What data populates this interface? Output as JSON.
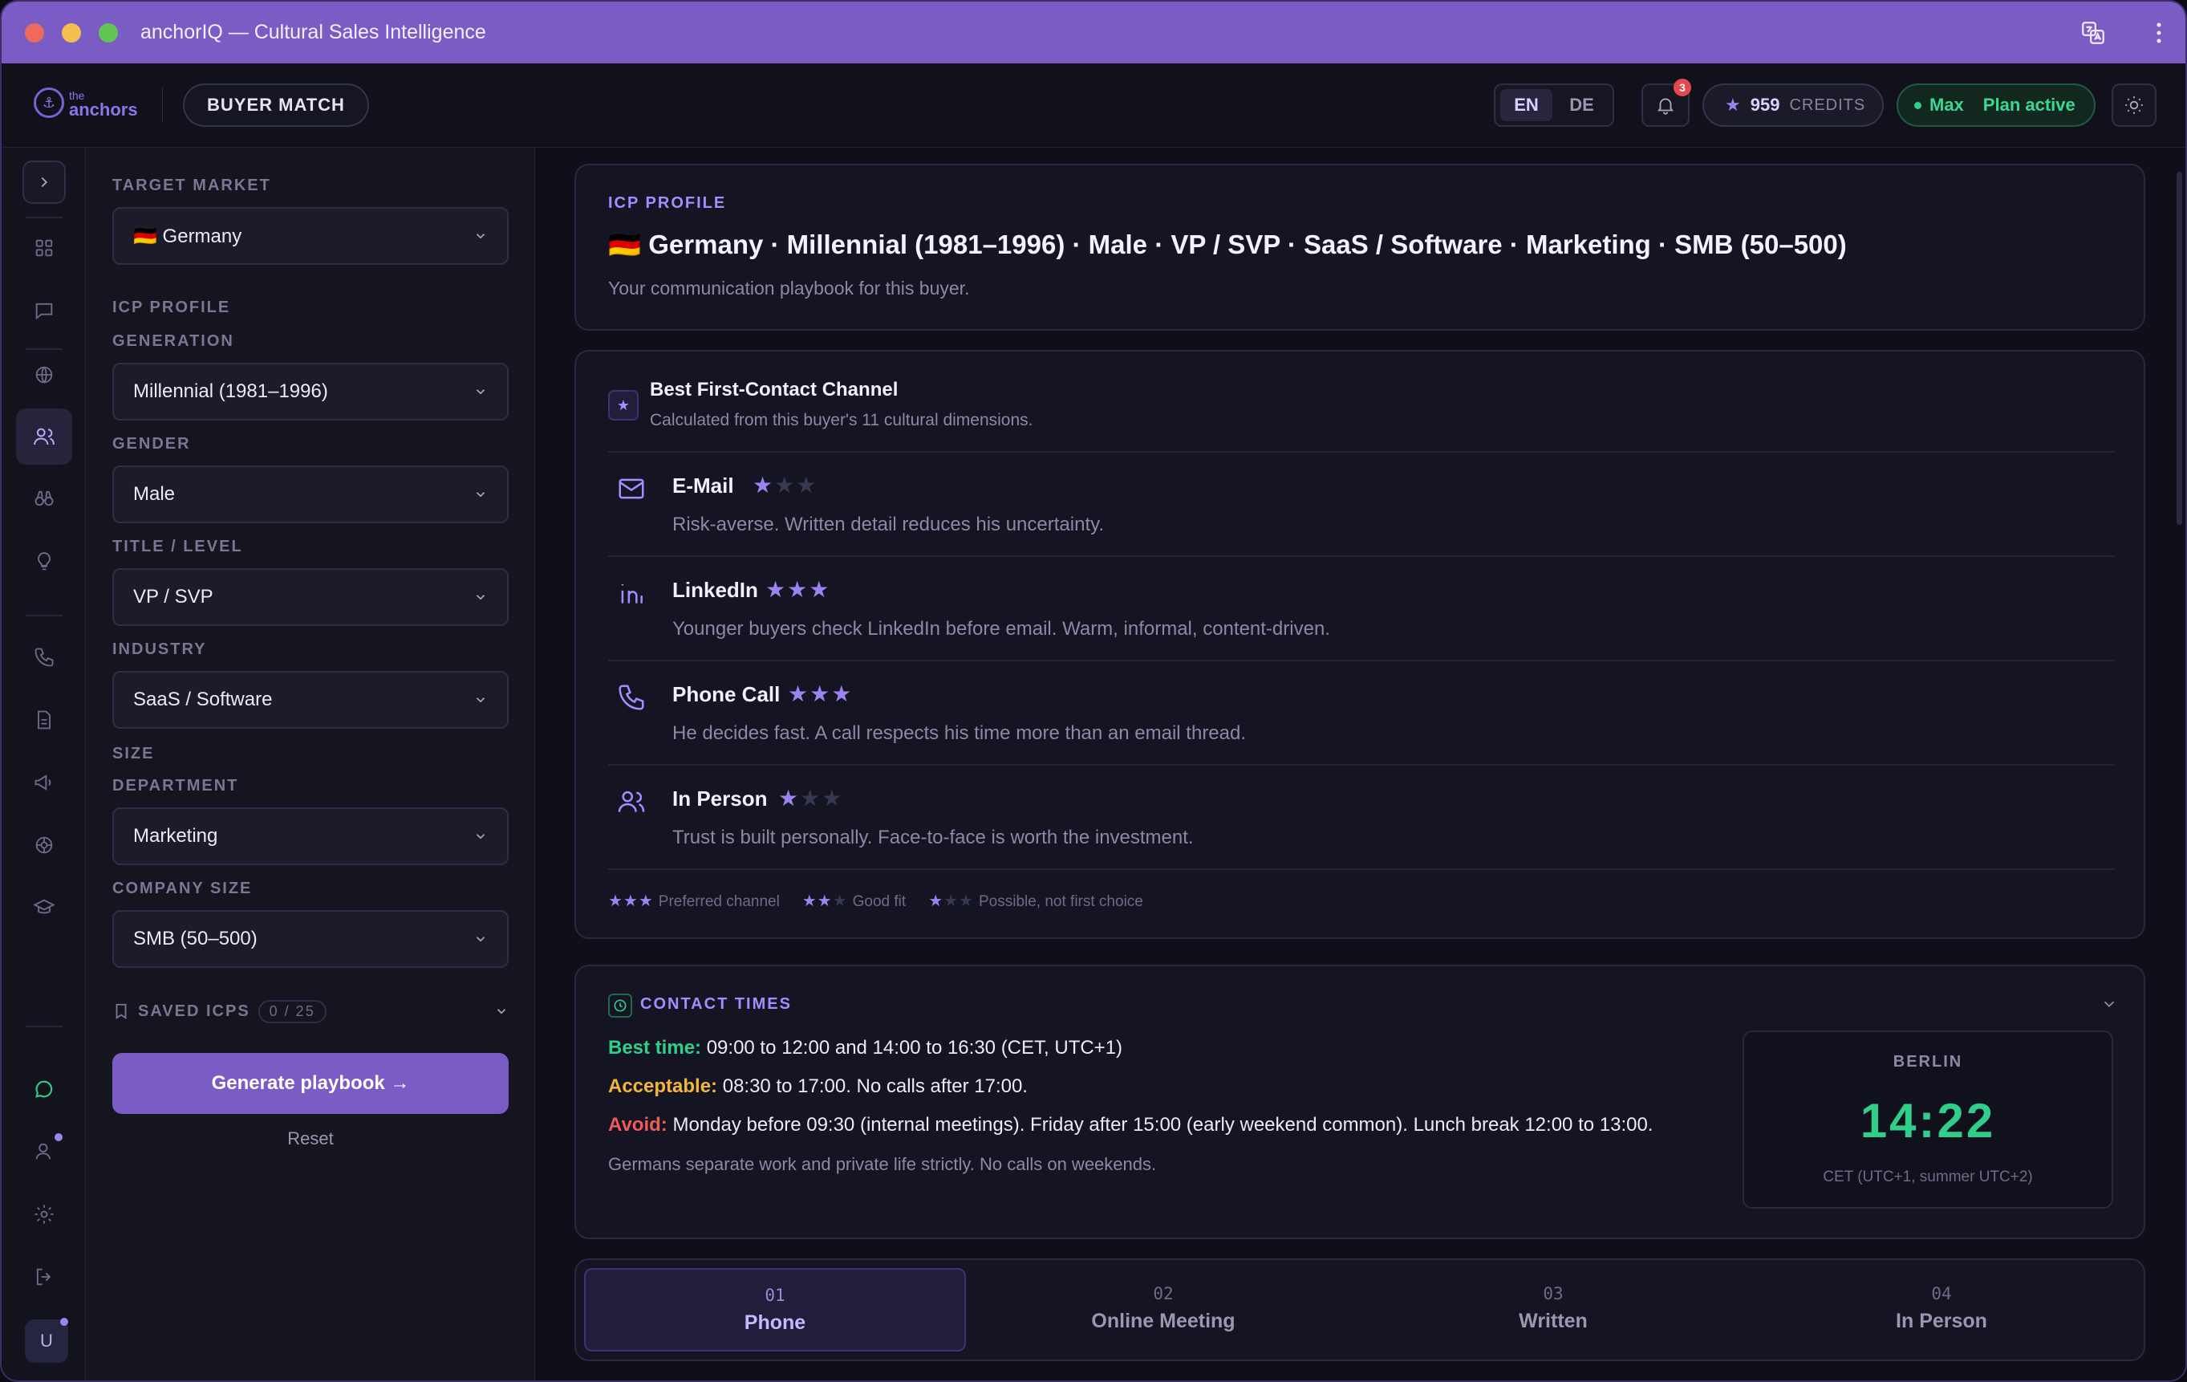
{
  "window": {
    "title": "anchorIQ — Cultural Sales Intelligence"
  },
  "header": {
    "logo_small": "the",
    "logo_big": "anchors",
    "buyer_match": "BUYER MATCH",
    "langs": [
      "EN",
      "DE"
    ],
    "notifications": "3",
    "credits_value": "959",
    "credits_label": "CREDITS",
    "plan_name": "Max",
    "plan_status": "Plan active"
  },
  "rail": {
    "avatar": "U"
  },
  "sidebar": {
    "target_market_label": "TARGET MARKET",
    "target_market": "🇩🇪 Germany",
    "icp_profile_label": "ICP PROFILE",
    "generation_label": "GENERATION",
    "generation": "Millennial (1981–1996)",
    "gender_label": "GENDER",
    "gender": "Male",
    "title_label": "TITLE / LEVEL",
    "title": "VP / SVP",
    "industry_label": "INDUSTRY",
    "industry": "SaaS / Software",
    "size_label": "SIZE",
    "department_label": "DEPARTMENT",
    "department": "Marketing",
    "company_size_label": "COMPANY SIZE",
    "company_size": "SMB (50–500)",
    "saved_label": "SAVED ICPS",
    "saved_count": "0 / 25",
    "generate": "Generate playbook →",
    "reset": "Reset"
  },
  "icp": {
    "label": "ICP PROFILE",
    "title": "🇩🇪 Germany · Millennial (1981–1996) · Male · VP / SVP · SaaS / Software · Marketing · SMB (50–500)",
    "subtitle": "Your communication playbook for this buyer."
  },
  "channels": {
    "title": "Best First-Contact Channel",
    "subtitle": "Calculated from this buyer's 11 cultural dimensions.",
    "items": [
      {
        "name": "E-Mail",
        "rating": 1,
        "desc": "Risk-averse. Written detail reduces his uncertainty.",
        "icon": "mail-icon"
      },
      {
        "name": "LinkedIn",
        "rating": 3,
        "desc": "Younger buyers check LinkedIn before email. Warm, informal, content-driven.",
        "icon": "linkedin-icon"
      },
      {
        "name": "Phone Call",
        "rating": 3,
        "desc": "He decides fast. A call respects his time more than an email thread.",
        "icon": "phone-icon"
      },
      {
        "name": "In Person",
        "rating": 1,
        "desc": "Trust is built personally. Face-to-face is worth the investment.",
        "icon": "people-icon"
      }
    ],
    "legend": [
      {
        "rating": 3,
        "text": "Preferred channel"
      },
      {
        "rating": 2,
        "text": "Good fit"
      },
      {
        "rating": 1,
        "text": "Possible, not first choice"
      }
    ]
  },
  "contact_times": {
    "label": "CONTACT TIMES",
    "best_key": "Best time:",
    "best": "09:00 to 12:00 and 14:00 to 16:30 (CET, UTC+1)",
    "acceptable_key": "Acceptable:",
    "acceptable": "08:30 to 17:00. No calls after 17:00.",
    "avoid_key": "Avoid:",
    "avoid": "Monday before 09:30 (internal meetings). Friday after 15:00 (early weekend common). Lunch break 12:00 to 13:00.",
    "note": "Germans separate work and private life strictly. No calls on weekends.",
    "clock_city": "BERLIN",
    "clock_time": "14:22",
    "clock_tz": "CET (UTC+1, summer UTC+2)"
  },
  "tabs": [
    {
      "num": "01",
      "label": "Phone"
    },
    {
      "num": "02",
      "label": "Online Meeting"
    },
    {
      "num": "03",
      "label": "Written"
    },
    {
      "num": "04",
      "label": "In Person"
    }
  ],
  "colors": {
    "accent": "#7b5cc4",
    "success": "#2fcf8a",
    "warning": "#f2b63c",
    "danger": "#ef5a5a"
  }
}
